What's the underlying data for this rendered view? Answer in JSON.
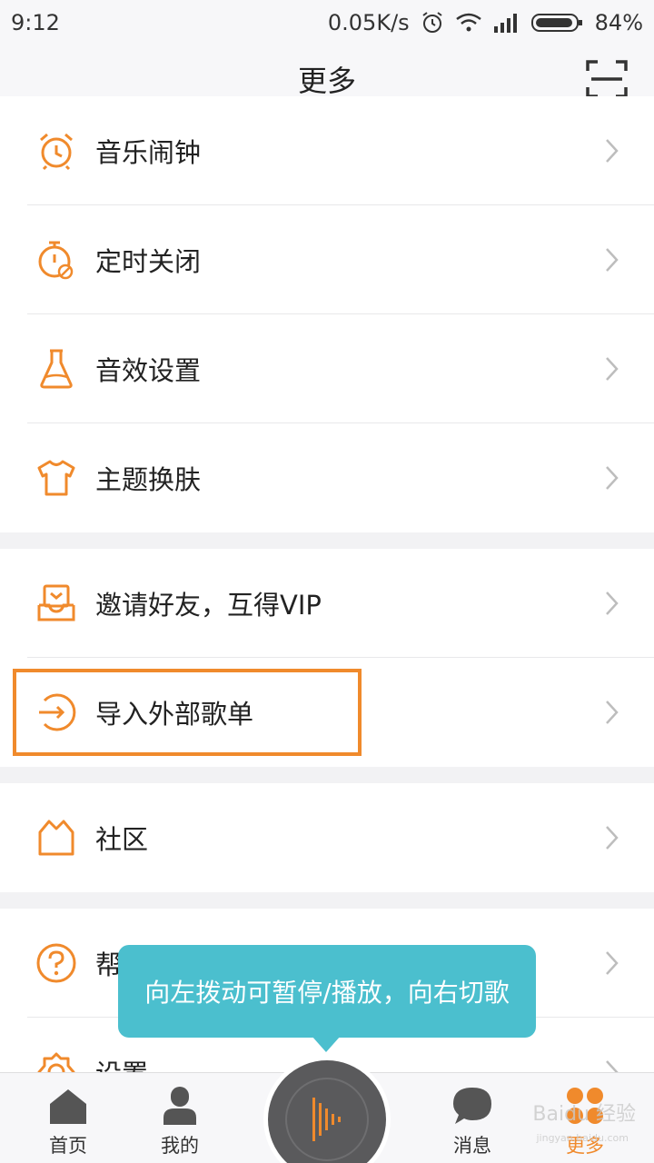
{
  "statusbar": {
    "time": "9:12",
    "net_speed": "0.05K/s",
    "battery": "84%"
  },
  "header": {
    "title": "更多",
    "scan_icon": "scan-icon"
  },
  "groups": [
    {
      "items": [
        {
          "label": "音乐闹钟",
          "icon": "alarm-clock-icon"
        },
        {
          "label": "定时关闭",
          "icon": "timer-off-icon"
        },
        {
          "label": "音效设置",
          "icon": "flask-icon"
        },
        {
          "label": "主题换肤",
          "icon": "shirt-icon"
        }
      ]
    },
    {
      "items": [
        {
          "label": "邀请好友，互得VIP",
          "icon": "gift-box-icon"
        },
        {
          "label": "导入外部歌单",
          "icon": "import-icon"
        }
      ]
    },
    {
      "items": [
        {
          "label": "社区",
          "icon": "community-icon"
        }
      ]
    },
    {
      "items": [
        {
          "label": "帮",
          "icon": "help-icon"
        },
        {
          "label": "设置",
          "icon": "settings-icon"
        }
      ]
    }
  ],
  "tooltip": {
    "text": "向左拨动可暂停/播放，向右切歌"
  },
  "bottomnav": {
    "items": [
      {
        "label": "首页",
        "icon": "home-icon"
      },
      {
        "label": "我的",
        "icon": "user-icon"
      },
      {
        "label": "消息",
        "icon": "message-icon"
      },
      {
        "label": "更多",
        "icon": "more-icon",
        "active": true
      }
    ]
  },
  "watermark": {
    "text": "Baidu 经验",
    "sub": "jingyan.baidu.com"
  },
  "colors": {
    "accent": "#f08a2c",
    "tooltip": "#4bbfce",
    "player": "#5a5a5c"
  }
}
